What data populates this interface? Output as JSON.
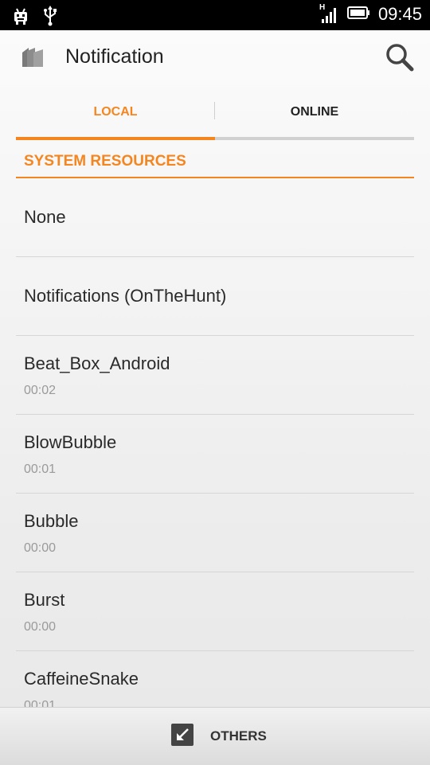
{
  "status_bar": {
    "time": "09:45",
    "network_type": "H",
    "icons": [
      "android-debug-icon",
      "usb-icon",
      "signal-icon",
      "battery-icon"
    ]
  },
  "action_bar": {
    "title": "Notification",
    "app_icon": "ringtone-app-icon",
    "search_icon": "search-icon"
  },
  "tabs": [
    {
      "label": "LOCAL",
      "active": true
    },
    {
      "label": "ONLINE",
      "active": false
    }
  ],
  "section": {
    "title": "SYSTEM RESOURCES"
  },
  "items": [
    {
      "name": "None",
      "duration": ""
    },
    {
      "name": "Notifications (OnTheHunt)",
      "duration": ""
    },
    {
      "name": "Beat_Box_Android",
      "duration": "00:02"
    },
    {
      "name": "BlowBubble",
      "duration": "00:01"
    },
    {
      "name": "Bubble",
      "duration": "00:00"
    },
    {
      "name": "Burst",
      "duration": "00:00"
    },
    {
      "name": "CaffeineSnake",
      "duration": "00:01"
    }
  ],
  "bottom_bar": {
    "others_label": "OTHERS",
    "others_icon": "arrow-in-box-icon"
  },
  "colors": {
    "accent": "#f5861f",
    "text": "#2a2a2a",
    "subtext": "#9a9a9a"
  }
}
